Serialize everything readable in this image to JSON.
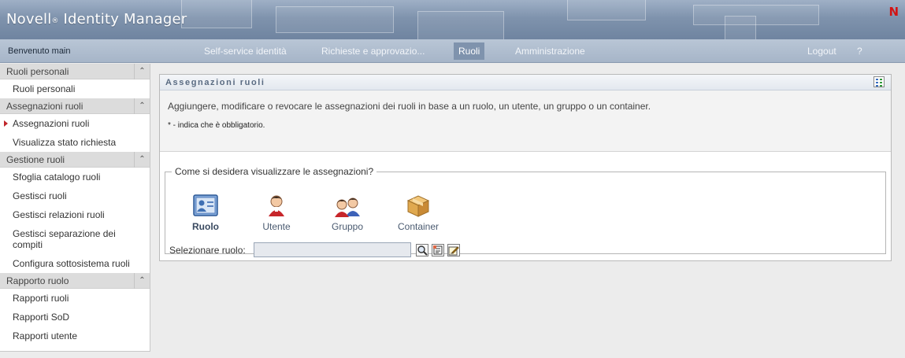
{
  "header": {
    "app_name": "Novell",
    "registered_mark": "®",
    "app_product": "Identity Manager",
    "logo_letter": "N",
    "logo_color": "#d21414"
  },
  "navbar": {
    "welcome": "Benvenuto main",
    "tabs": [
      {
        "label": "Self-service identità",
        "active": false
      },
      {
        "label": "Richieste e approvazio...",
        "active": false
      },
      {
        "label": "Ruoli",
        "active": true
      },
      {
        "label": "Amministrazione",
        "active": false
      }
    ],
    "logout": "Logout",
    "help": "?"
  },
  "sidebar": {
    "sections": [
      {
        "title": "Ruoli personali",
        "items": [
          {
            "label": "Ruoli personali"
          }
        ]
      },
      {
        "title": "Assegnazioni ruoli",
        "items": [
          {
            "label": "Assegnazioni ruoli",
            "active": true
          },
          {
            "label": "Visualizza stato richiesta"
          }
        ]
      },
      {
        "title": "Gestione ruoli",
        "items": [
          {
            "label": "Sfoglia catalogo ruoli"
          },
          {
            "label": "Gestisci ruoli"
          },
          {
            "label": "Gestisci relazioni ruoli"
          },
          {
            "label": "Gestisci separazione dei compiti"
          },
          {
            "label": "Configura sottosistema ruoli"
          }
        ]
      },
      {
        "title": "Rapporto ruolo",
        "items": [
          {
            "label": "Rapporti ruoli"
          },
          {
            "label": "Rapporti SoD"
          },
          {
            "label": "Rapporti utente"
          }
        ]
      }
    ]
  },
  "panel": {
    "title": "Assegnazioni ruoli",
    "description": "Aggiungere, modificare o revocare le assegnazioni dei ruoli in base a un ruolo, un utente, un gruppo o un container.",
    "required_note": "* - indica che è obbligatorio.",
    "fieldset_legend": "Come si desidera visualizzare le assegnazioni?",
    "options": [
      {
        "label": "Ruolo",
        "icon": "role-card-icon",
        "selected": true
      },
      {
        "label": "Utente",
        "icon": "user-icon",
        "selected": false
      },
      {
        "label": "Gruppo",
        "icon": "group-icon",
        "selected": false
      },
      {
        "label": "Container",
        "icon": "container-box-icon",
        "selected": false
      }
    ],
    "select_label": "Selezionare ruolo:",
    "select_value": "",
    "buttons": [
      {
        "icon": "search-icon"
      },
      {
        "icon": "history-list-icon"
      },
      {
        "icon": "edit-icon"
      }
    ]
  }
}
